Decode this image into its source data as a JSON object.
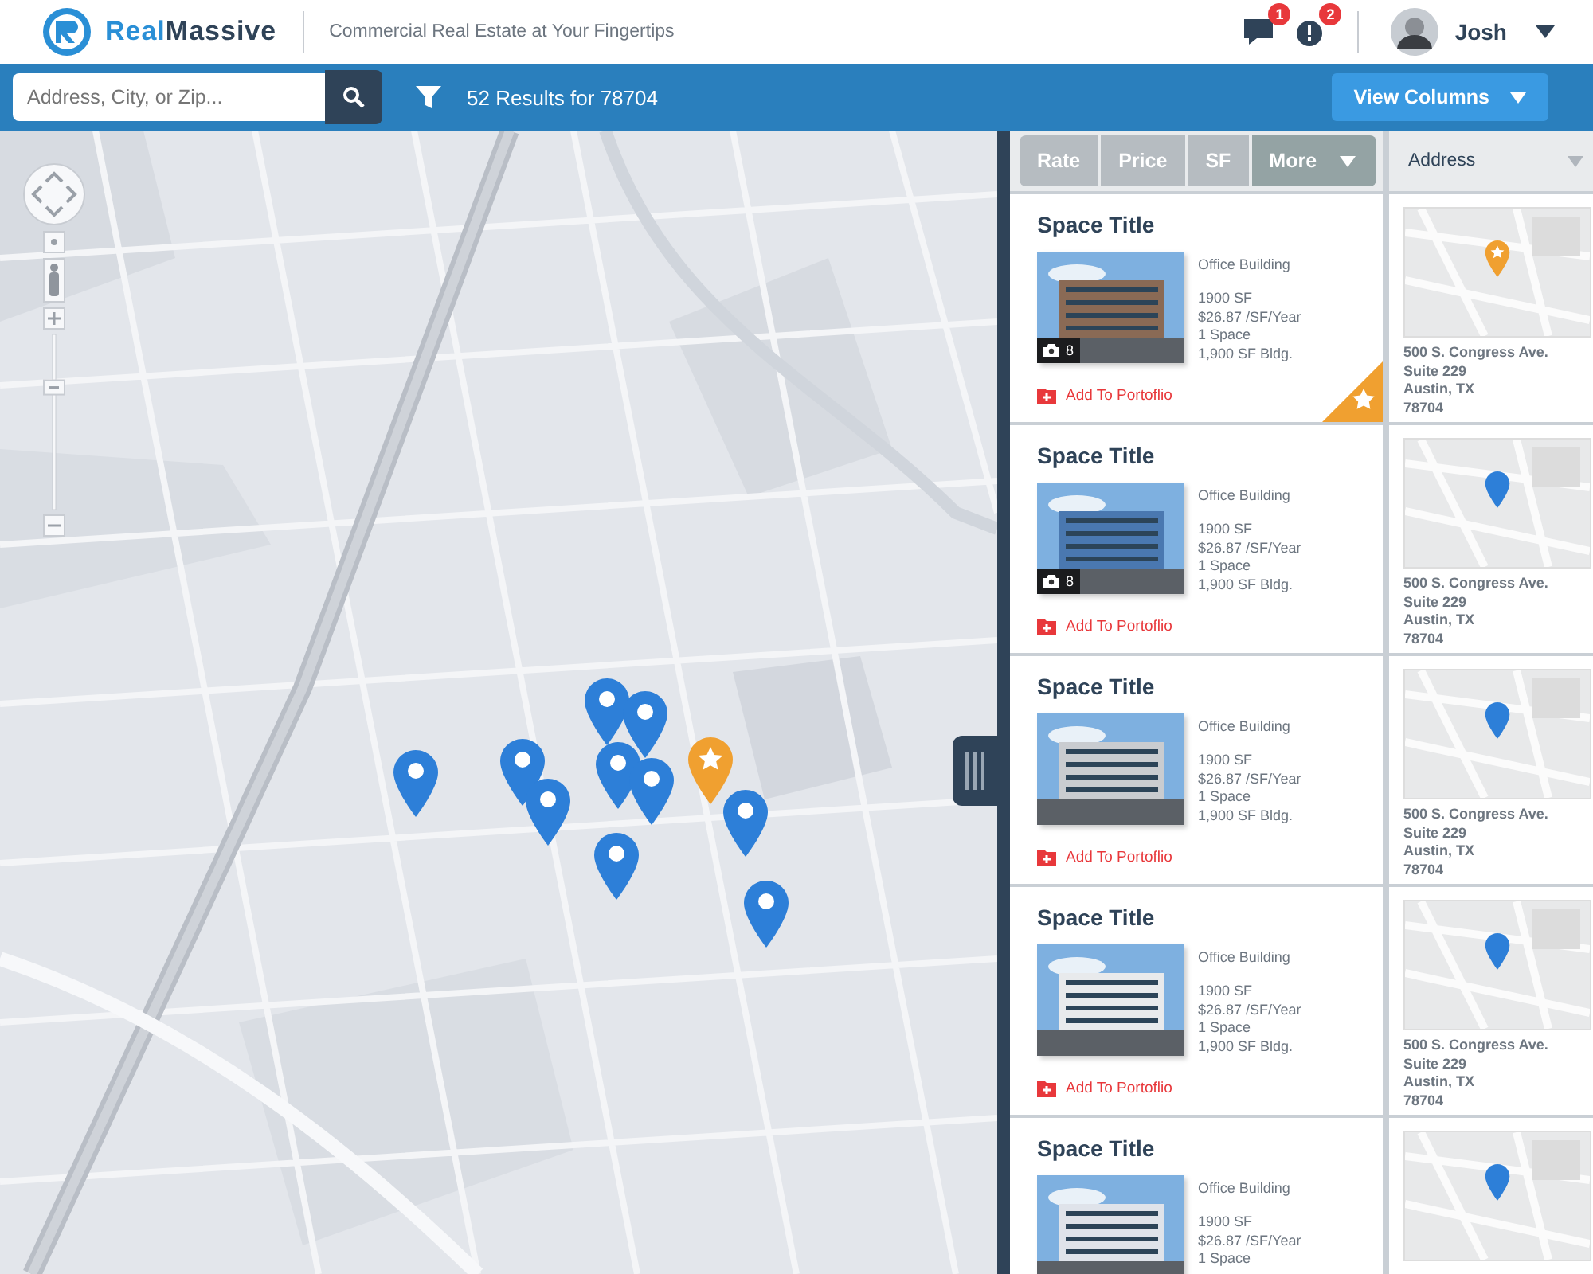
{
  "header": {
    "logo": [
      "Real",
      "Massive"
    ],
    "tagline": "Commercial Real Estate at Your Fingertips",
    "messages_badge": "1",
    "alerts_badge": "2",
    "user": "Josh"
  },
  "toolbar": {
    "search": {
      "placeholder": "Address, City, or Zip..."
    },
    "results": "52 Results for 78704",
    "view_columns": "View Columns"
  },
  "map": {
    "zoom": {
      "level": 0.72
    },
    "pins": [
      {
        "starred": false
      },
      {
        "starred": false
      },
      {
        "starred": false
      },
      {
        "starred": false
      },
      {
        "starred": false
      },
      {
        "starred": false
      },
      {
        "starred": false
      },
      {
        "starred": false
      },
      {
        "starred": false
      },
      {
        "starred": false
      },
      {
        "starred": true
      }
    ]
  },
  "sort_tabs": [
    {
      "label": "Rate",
      "selected": false
    },
    {
      "label": "Price",
      "selected": false
    },
    {
      "label": "SF",
      "selected": false
    },
    {
      "label": "More",
      "selected": true
    }
  ],
  "address_header": "Address",
  "listings": [
    {
      "title": "Space Title",
      "photo_count": "8",
      "type": "Office Building",
      "details": [
        "1900 SF",
        "$26.87 /SF/Year",
        "1 Space",
        "1,900 SF Bldg."
      ],
      "action": "Add To Portoflio",
      "favorite": true,
      "address": [
        "500 S. Congress Ave.",
        "Suite 229",
        "Austin, TX",
        "78704"
      ]
    },
    {
      "title": "Space Title",
      "photo_count": "8",
      "type": "Office Building",
      "details": [
        "1900 SF",
        "$26.87 /SF/Year",
        "1 Space",
        "1,900 SF Bldg."
      ],
      "action": "Add To Portoflio",
      "favorite": false,
      "address": [
        "500 S. Congress Ave.",
        "Suite 229",
        "Austin, TX",
        "78704"
      ]
    },
    {
      "title": "Space Title",
      "type": "Office Building",
      "details": [
        "1900 SF",
        "$26.87 /SF/Year",
        "1 Space",
        "1,900 SF Bldg."
      ],
      "action": "Add To Portoflio",
      "favorite": false,
      "address": [
        "500 S. Congress Ave.",
        "Suite 229",
        "Austin, TX",
        "78704"
      ]
    },
    {
      "title": "Space Title",
      "type": "Office Building",
      "details": [
        "1900 SF",
        "$26.87 /SF/Year",
        "1 Space",
        "1,900 SF Bldg."
      ],
      "action": "Add To Portoflio",
      "favorite": false,
      "address": [
        "500 S. Congress Ave.",
        "Suite 229",
        "Austin, TX",
        "78704"
      ]
    },
    {
      "title": "Space Title",
      "type": "Office Building",
      "details": [
        "1900 SF",
        "$26.87 /SF/Year",
        "1 Space"
      ],
      "favorite": false
    }
  ]
}
